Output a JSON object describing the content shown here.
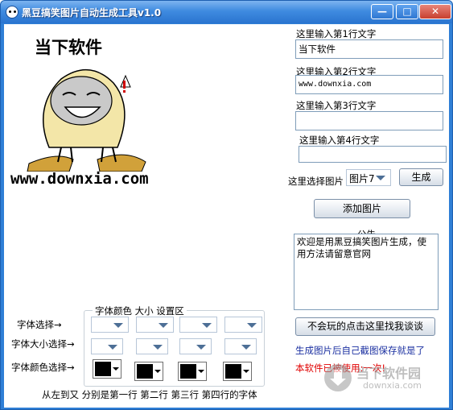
{
  "window": {
    "title": "黑豆搞笑图片自动生成工具v1.0",
    "min": "—",
    "max": "□",
    "close": "✕"
  },
  "preview": {
    "top_text": "当下软件",
    "bottom_text": "www.downxia.com"
  },
  "inputs": [
    {
      "label": "这里输入第1行文字",
      "value": "当下软件"
    },
    {
      "label": "这里输入第2行文字",
      "value": "www.downxia.com"
    },
    {
      "label": "这里输入第3行文字",
      "value": ""
    },
    {
      "label": "这里输入第4行文字",
      "value": ""
    }
  ],
  "picture_select": {
    "label": "这里选择图片",
    "value": "图片7",
    "generate": "生成"
  },
  "add_picture": "添加图片",
  "notice": {
    "title": "公告",
    "text": "欢迎是用黑豆搞笑图片生成，使用方法请留意官网"
  },
  "feedback_button": "不会玩的点击这里找我谈谈",
  "hint_text": "生成图片后自己截图保存就是了",
  "usage_text": "本软件已被使用:一次!",
  "font_group": {
    "title": "字体颜色 大小 设置区",
    "row_font": "字体选择→",
    "row_size": "字体大小选择→",
    "row_color": "字体颜色选择→",
    "footer": "从左到又  分别是第一行  第二行  第三行  第四行的字体"
  },
  "watermark": {
    "brand": "当下软件园",
    "url": "downxia.com"
  },
  "colors": {
    "accent_title": "#2f7fd6",
    "hint": "#1a2fa0",
    "usage": "#e00000"
  }
}
